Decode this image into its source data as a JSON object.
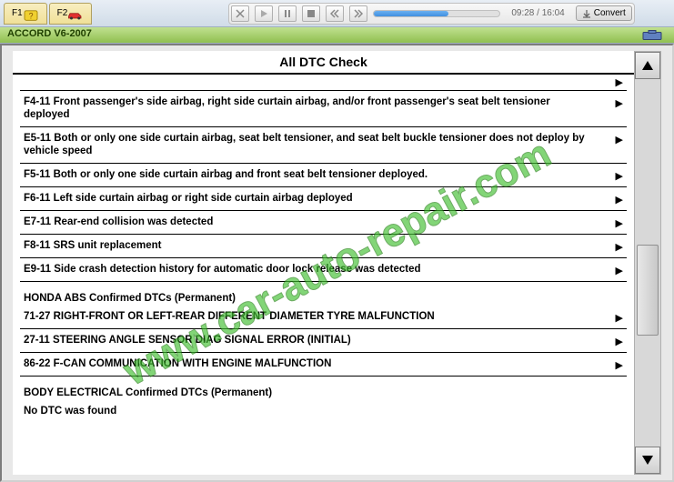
{
  "toolbar": {
    "tabs": [
      {
        "label": "F1"
      },
      {
        "label": "F2"
      }
    ],
    "time": "09:28 / 16:04",
    "convert_label": "Convert"
  },
  "breadcrumb": {
    "title": "ACCORD V6-2007"
  },
  "pane": {
    "title": "All DTC Check"
  },
  "dtc": {
    "items": [
      {
        "text": "F4-11 Front passenger's side airbag, right side curtain airbag, and/or front passenger's seat belt tensioner deployed"
      },
      {
        "text": "E5-11 Both or only one side curtain airbag, seat belt tensioner, and seat belt buckle tensioner does not deploy by vehicle speed"
      },
      {
        "text": "F5-11 Both or only one side curtain airbag and front seat belt tensioner deployed."
      },
      {
        "text": "F6-11 Left side curtain airbag or right side curtain airbag deployed"
      },
      {
        "text": "E7-11 Rear-end collision was detected"
      },
      {
        "text": "F8-11 SRS unit replacement"
      },
      {
        "text": "E9-11 Side crash detection history for automatic door lock release was detected"
      }
    ],
    "section2_header": "HONDA ABS Confirmed DTCs (Permanent)",
    "items2": [
      {
        "text": "71-27 RIGHT-FRONT OR LEFT-REAR DIFFERENT DIAMETER TYRE MALFUNCTION"
      },
      {
        "text": "27-11 STEERING ANGLE SENSOR DIAG SIGNAL ERROR (INITIAL)"
      },
      {
        "text": "86-22 F-CAN COMMUNICATION WITH ENGINE MALFUNCTION"
      }
    ],
    "section3_header": "BODY ELECTRICAL Confirmed DTCs (Permanent)",
    "no_dtc": "No DTC was found"
  },
  "watermark": "www.car-auto-repair.com"
}
